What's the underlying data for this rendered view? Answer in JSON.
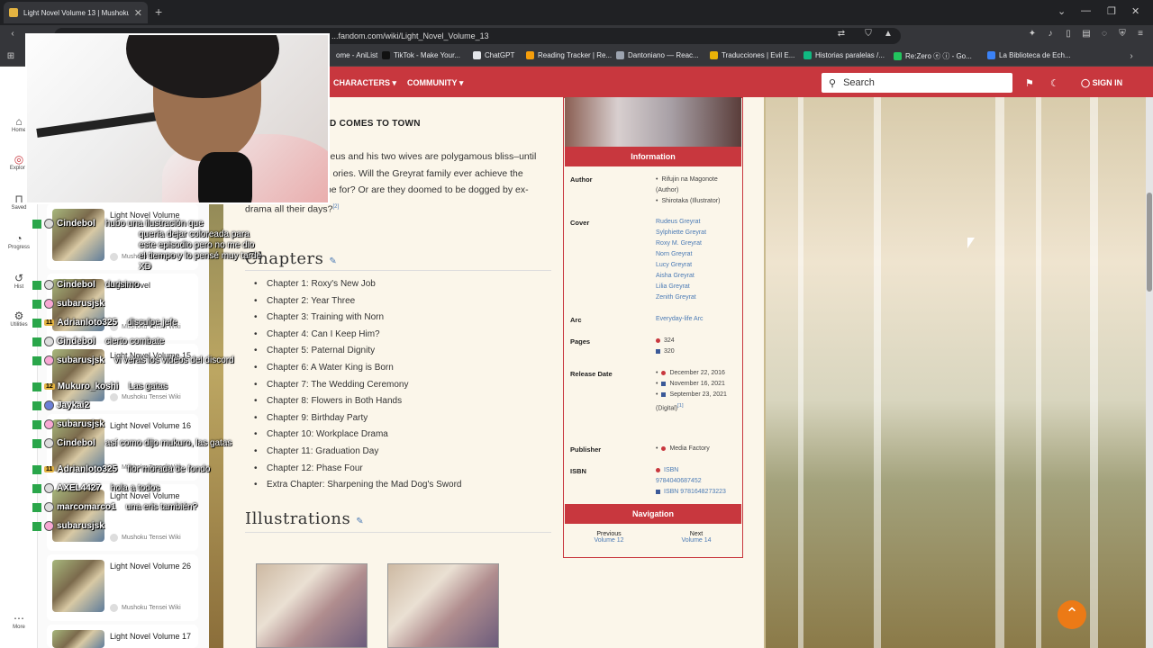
{
  "browser": {
    "tab_title": "Light Novel Volume 13 | Mushoku",
    "url": "...fandom.com/wiki/Light_Novel_Volume_13",
    "bookmarks": [
      {
        "label": "ome - AniList",
        "color": "#3b82f6"
      },
      {
        "label": "TikTok - Make Your...",
        "color": "#111111"
      },
      {
        "label": "ChatGPT",
        "color": "#e5e7eb"
      },
      {
        "label": "Reading Tracker | Re...",
        "color": "#f59e0b"
      },
      {
        "label": "Dantoniano — Reac...",
        "color": "#9ca3af"
      },
      {
        "label": "Traducciones | Evil E...",
        "color": "#eab308"
      },
      {
        "label": "Historias paralelas /...",
        "color": "#10b981"
      },
      {
        "label": "Re:Zero ⓔ ⓘ - Go...",
        "color": "#22c55e"
      },
      {
        "label": "La Biblioteca de Ech...",
        "color": "#3b82f6"
      }
    ]
  },
  "left_rail": {
    "items": [
      "Home",
      "Explore",
      "Saved",
      "Progress",
      "Hist",
      "Utilities",
      "More"
    ]
  },
  "side_panel": {
    "cards": [
      {
        "title": "Light Novel Volume",
        "source": "Mushoku Tensei Wiki"
      },
      {
        "title": "Light Novel",
        "source": "Mushoku Tensei Wiki"
      },
      {
        "title": "Light Novel Volume 15",
        "source": "Mushoku Tensei Wiki"
      },
      {
        "title": "Light Novel Volume 16",
        "source": "Mushoku Tensei Wiki"
      },
      {
        "title": "Light Novel Volume",
        "source": "Mushoku Tensei Wiki"
      },
      {
        "title": "Light Novel Volume 26",
        "source": "Mushoku Tensei Wiki"
      },
      {
        "title": "Light Novel Volume 17",
        "source": ""
      }
    ]
  },
  "chat": [
    {
      "user": "Cindebol",
      "msg": "hubo una ilustración que",
      "color": "#ffffff"
    },
    {
      "user": "",
      "msg": "quería dejar coloreada para",
      "color": "#ffffff"
    },
    {
      "user": "",
      "msg": "este episodio pero no me dio",
      "color": "#ffffff"
    },
    {
      "user": "",
      "msg": "el tiempo y lo pensé muy tarde",
      "color": "#ffffff"
    },
    {
      "user": "",
      "msg": "XD",
      "color": "#ffffff"
    },
    {
      "user": "Cindebol",
      "msg": "durisimo",
      "color": "#ffffff"
    },
    {
      "user": "subarusjsk",
      "msg": "",
      "color": "#ffffff"
    },
    {
      "user": "Adrianloto325",
      "msg": "disculpe jefe",
      "color": "#ffffff"
    },
    {
      "user": "Cindebol",
      "msg": "cierto combate",
      "color": "#ffffff"
    },
    {
      "user": "subarusjsk",
      "msg": "vi verás los videos del discord",
      "color": "#ffffff"
    },
    {
      "user": "Mukuro_koshi",
      "msg": "Las gatas",
      "color": "#ffffff"
    },
    {
      "user": "Jaykai2",
      "msg": "",
      "color": "#ffffff"
    },
    {
      "user": "subarusjsk",
      "msg": "",
      "color": "#ffffff"
    },
    {
      "user": "Cindebol",
      "msg": "así como dijo mukuro, las gatas",
      "color": "#ffffff"
    },
    {
      "user": "Adrianloto325",
      "msg": "flor morada de fondo",
      "color": "#ffffff"
    },
    {
      "user": "AXEL4427",
      "msg": "hola a todos",
      "color": "#ffffff"
    },
    {
      "user": "marcomarco1",
      "msg": "una eris también?",
      "color": "#ffffff"
    },
    {
      "user": "subarusjsk",
      "msg": "",
      "color": "#ffffff"
    }
  ],
  "wiki_nav": {
    "characters": "CHARACTERS",
    "community": "COMMUNITY",
    "search_placeholder": "Search",
    "signin": "SIGN IN"
  },
  "article": {
    "heading": "D COMES TO TOWN",
    "blurb": "ef behind them, Rudeus and his two wives are polygamous bliss–until an old flame arrives. ories. Will the Greyrat family ever achieve the domesticity they hope for? Or are they doomed to be dogged by ex-drama all their days?",
    "blurb_ref": "[2]",
    "chapters_title": "Chapters",
    "chapters": [
      "Chapter 1: Roxy's New Job",
      "Chapter 2: Year Three",
      "Chapter 3: Training with Norn",
      "Chapter 4: Can I Keep Him?",
      "Chapter 5: Paternal Dignity",
      "Chapter 6: A Water King is Born",
      "Chapter 7: The Wedding Ceremony",
      "Chapter 8: Flowers in Both Hands",
      "Chapter 9: Birthday Party",
      "Chapter 10: Workplace Drama",
      "Chapter 11: Graduation Day",
      "Chapter 12: Phase Four",
      "Extra Chapter: Sharpening the Mad Dog's Sword"
    ],
    "illustrations_title": "Illustrations"
  },
  "infobox": {
    "header": "Information",
    "author_label": "Author",
    "author": [
      "Rifujin na Magonote (Author)",
      "Shirotaka (Illustrator)"
    ],
    "cover_label": "Cover",
    "cover": [
      "Rudeus Greyrat",
      "Sylphiette Greyrat",
      "Roxy M. Greyrat",
      "Norn Greyrat",
      "Lucy Greyrat",
      "Aisha Greyrat",
      "Lilia Greyrat",
      "Zenith Greyrat"
    ],
    "arc_label": "Arc",
    "arc": "Everyday-life Arc",
    "pages_label": "Pages",
    "pages_jp": "324",
    "pages_en": "320",
    "release_label": "Release Date",
    "release_jp": "December 22, 2016",
    "release_en": "November 16, 2021",
    "release_digital": "September 23, 2021 (Digital)",
    "release_ref": "[1]",
    "publisher_label": "Publisher",
    "publisher": "Media Factory",
    "isbn_label": "ISBN",
    "isbn_jp_label": "ISBN",
    "isbn_jp": "9784040687452",
    "isbn_en_label": "ISBN",
    "isbn_en": "9781648273223",
    "navigation": "Navigation",
    "prev_label": "Previous",
    "prev_vol": "Volume 12",
    "next_label": "Next",
    "next_vol": "Volume 14"
  },
  "colors": {
    "wiki_red": "#c8373e",
    "link_blue": "#4a7ab5",
    "top_button": "#ec7a16"
  }
}
